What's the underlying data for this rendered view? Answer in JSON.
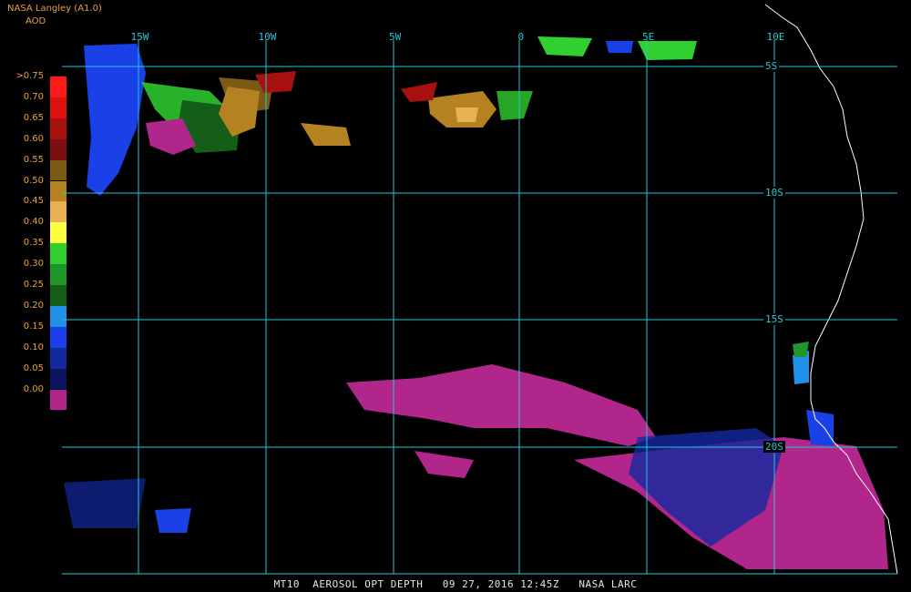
{
  "header": {
    "title": "NASA Langley (A1.0)",
    "subtitle": "AOD"
  },
  "legend": {
    "items": [
      {
        "label": ">0.75",
        "color": "#ff1a1a"
      },
      {
        "label": "0.70",
        "color": "#e01010"
      },
      {
        "label": "0.65",
        "color": "#a81010"
      },
      {
        "label": "0.60",
        "color": "#7a1010"
      },
      {
        "label": "0.55",
        "color": "#7a5a14"
      },
      {
        "label": "0.50",
        "color": "#b48220"
      },
      {
        "label": "0.45",
        "color": "#e8b050"
      },
      {
        "label": "0.40",
        "color": "#ffff40"
      },
      {
        "label": "0.35",
        "color": "#30d030"
      },
      {
        "label": "0.30",
        "color": "#20962a"
      },
      {
        "label": "0.25",
        "color": "#155e18"
      },
      {
        "label": "0.20",
        "color": "#2090e8"
      },
      {
        "label": "0.15",
        "color": "#1a40e8"
      },
      {
        "label": "0.10",
        "color": "#1428a0"
      },
      {
        "label": "0.05",
        "color": "#0a1660"
      },
      {
        "label": "0.00",
        "color": "#b0268a"
      }
    ]
  },
  "axes": {
    "longitude_labels": [
      "15W",
      "10W",
      "5W",
      "0",
      "5E",
      "10E"
    ],
    "latitude_labels": [
      "5S",
      "10S",
      "15S",
      "20S"
    ],
    "grid_color": "#22c8d8"
  },
  "footer": {
    "caption": "MT10  AEROSOL OPT DEPTH   09 27, 2016 12:45Z   NASA LARC"
  }
}
